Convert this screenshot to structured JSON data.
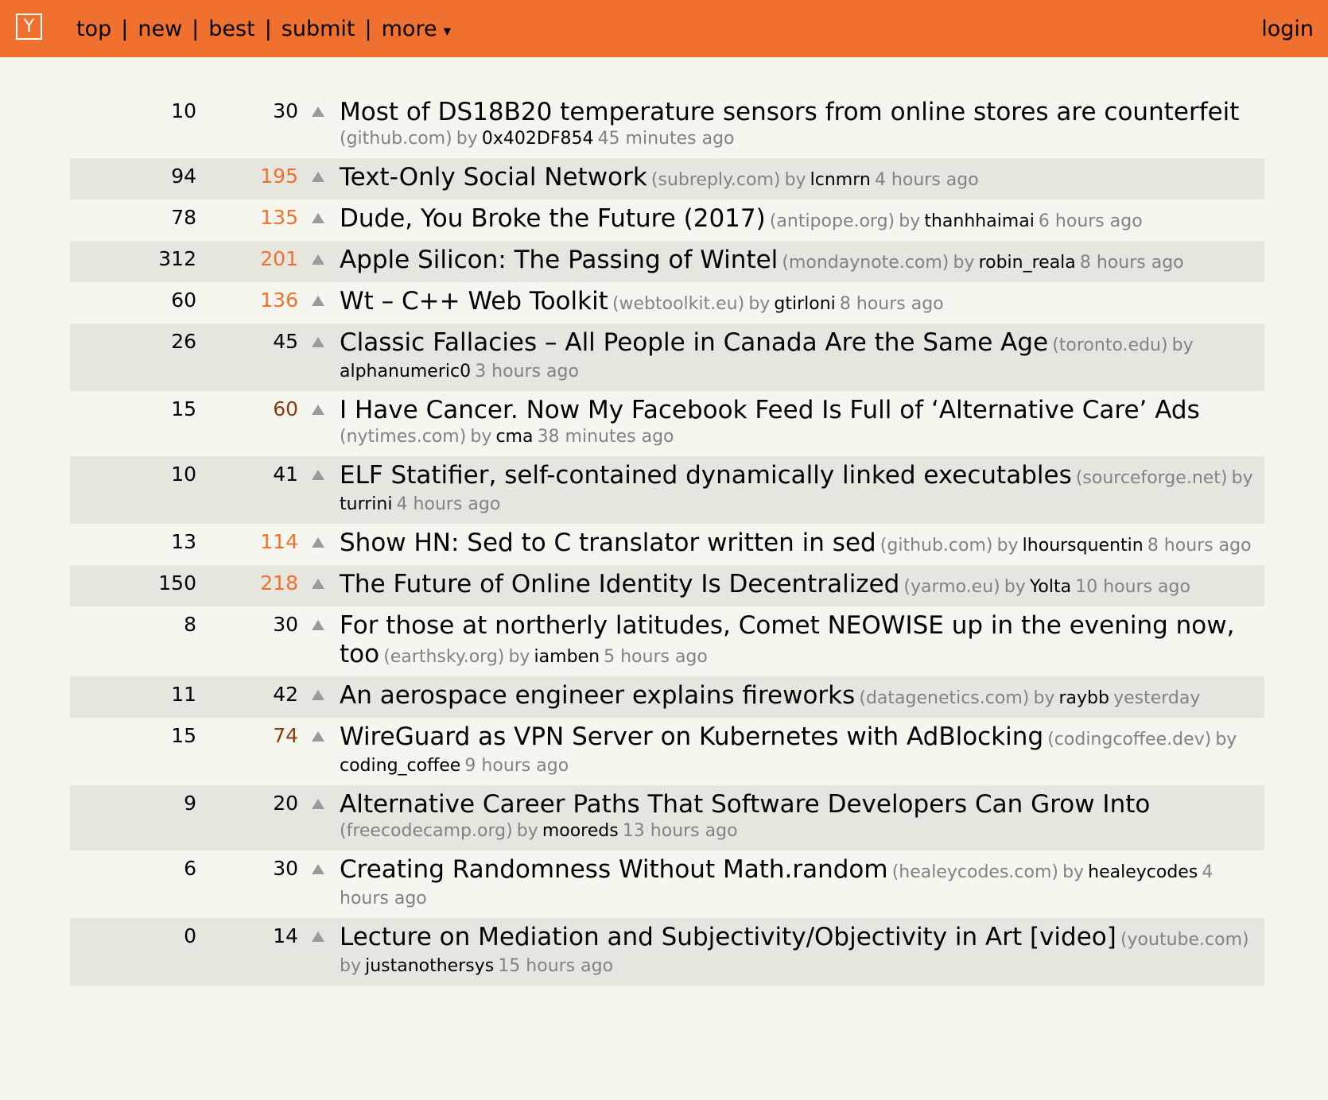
{
  "header": {
    "logo": "Y",
    "nav": [
      "top",
      "new",
      "best",
      "submit",
      "more"
    ],
    "more_caret": "▾",
    "login": "login"
  },
  "colors": {
    "header_bg": "#f07030",
    "page_bg": "#f6f6ef",
    "alt_row_bg": "#e6e6df",
    "points_high": "#f07030",
    "points_mid": "#8a3d12",
    "points_low": "#000000",
    "meta_text": "#828282"
  },
  "by_word": "by",
  "stories": [
    {
      "comments": "10",
      "points": "30",
      "level": "low",
      "title": "Most of DS18B20 temperature sensors from online stores are counterfeit",
      "domain": "(github.com)",
      "user": "0x402DF854",
      "time": "45 minutes ago"
    },
    {
      "comments": "94",
      "points": "195",
      "level": "high",
      "title": "Text-Only Social Network",
      "domain": "(subreply.com)",
      "user": "lcnmrn",
      "time": "4 hours ago"
    },
    {
      "comments": "78",
      "points": "135",
      "level": "high",
      "title": "Dude, You Broke the Future (2017)",
      "domain": "(antipope.org)",
      "user": "thanhhaimai",
      "time": "6 hours ago"
    },
    {
      "comments": "312",
      "points": "201",
      "level": "high",
      "title": "Apple Silicon: The Passing of Wintel",
      "domain": "(mondaynote.com)",
      "user": "robin_reala",
      "time": "8 hours ago"
    },
    {
      "comments": "60",
      "points": "136",
      "level": "high",
      "title": "Wt – C++ Web Toolkit",
      "domain": "(webtoolkit.eu)",
      "user": "gtirloni",
      "time": "8 hours ago"
    },
    {
      "comments": "26",
      "points": "45",
      "level": "low",
      "title": "Classic Fallacies – All People in Canada Are the Same Age",
      "domain": "(toronto.edu)",
      "user": "alphanumeric0",
      "time": "3 hours ago"
    },
    {
      "comments": "15",
      "points": "60",
      "level": "mid",
      "title": "I Have Cancer. Now My Facebook Feed Is Full of ‘Alternative Care’ Ads",
      "domain": "(nytimes.com)",
      "user": "cma",
      "time": "38 minutes ago"
    },
    {
      "comments": "10",
      "points": "41",
      "level": "low",
      "title": "ELF Statifier, self-contained dynamically linked executables",
      "domain": "(sourceforge.net)",
      "user": "turrini",
      "time": "4 hours ago"
    },
    {
      "comments": "13",
      "points": "114",
      "level": "high",
      "title": "Show HN: Sed to C translator written in sed",
      "domain": "(github.com)",
      "user": "lhoursquentin",
      "time": "8 hours ago"
    },
    {
      "comments": "150",
      "points": "218",
      "level": "high",
      "title": "The Future of Online Identity Is Decentralized",
      "domain": "(yarmo.eu)",
      "user": "Yolta",
      "time": "10 hours ago"
    },
    {
      "comments": "8",
      "points": "30",
      "level": "low",
      "title": "For those at northerly latitudes, Comet NEOWISE up in the evening now, too",
      "domain": "(earthsky.org)",
      "user": "iamben",
      "time": "5 hours ago"
    },
    {
      "comments": "11",
      "points": "42",
      "level": "low",
      "title": "An aerospace engineer explains fireworks",
      "domain": "(datagenetics.com)",
      "user": "raybb",
      "time": "yesterday"
    },
    {
      "comments": "15",
      "points": "74",
      "level": "mid",
      "title": "WireGuard as VPN Server on Kubernetes with AdBlocking",
      "domain": "(codingcoffee.dev)",
      "user": "coding_coffee",
      "time": "9 hours ago"
    },
    {
      "comments": "9",
      "points": "20",
      "level": "low",
      "title": "Alternative Career Paths That Software Developers Can Grow Into",
      "domain": "(freecodecamp.org)",
      "user": "mooreds",
      "time": "13 hours ago"
    },
    {
      "comments": "6",
      "points": "30",
      "level": "low",
      "title": "Creating Randomness Without Math.random",
      "domain": "(healeycodes.com)",
      "user": "healeycodes",
      "time": "4 hours ago"
    },
    {
      "comments": "0",
      "points": "14",
      "level": "low",
      "title": "Lecture on Mediation and Subjectivity/Objectivity in Art [video]",
      "domain": "(youtube.com)",
      "user": "justanothersys",
      "time": "15 hours ago"
    }
  ]
}
